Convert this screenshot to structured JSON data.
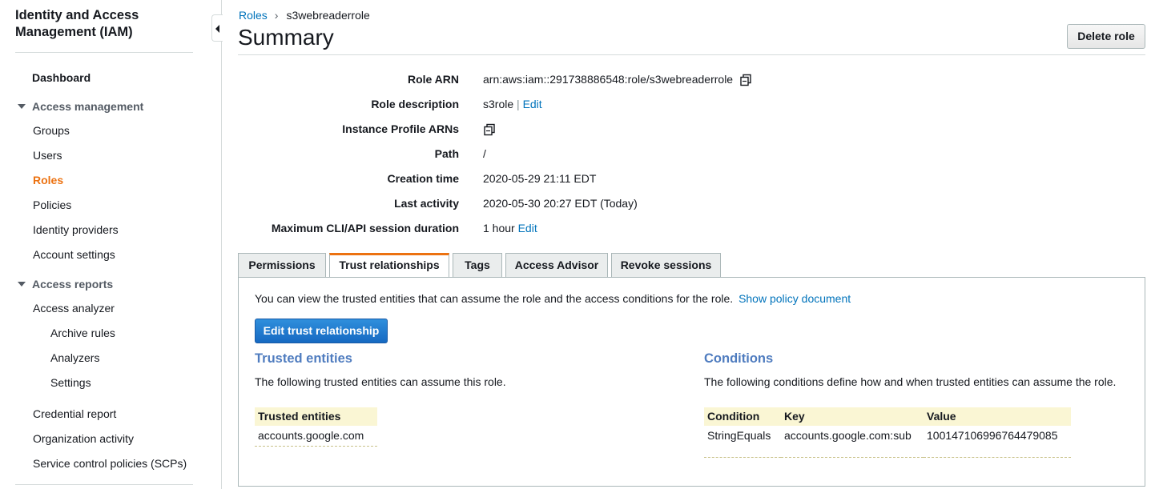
{
  "sidebar": {
    "title": "Identity and Access Management (IAM)",
    "dashboard": "Dashboard",
    "access_management": {
      "label": "Access management",
      "items": [
        "Groups",
        "Users",
        "Roles",
        "Policies",
        "Identity providers",
        "Account settings"
      ]
    },
    "access_reports": {
      "label": "Access reports",
      "analyzer": "Access analyzer",
      "analyzer_items": [
        "Archive rules",
        "Analyzers",
        "Settings"
      ],
      "items": [
        "Credential report",
        "Organization activity",
        "Service control policies (SCPs)"
      ]
    }
  },
  "breadcrumb": {
    "parent": "Roles",
    "current": "s3webreaderrole"
  },
  "page": {
    "title": "Summary",
    "delete_button": "Delete role"
  },
  "summary": {
    "role_arn_label": "Role ARN",
    "role_arn": "arn:aws:iam::291738886548:role/s3webreaderrole",
    "description_label": "Role description",
    "description": "s3role",
    "description_sep": "|",
    "description_edit": "Edit",
    "instance_profile_label": "Instance Profile ARNs",
    "path_label": "Path",
    "path": "/",
    "creation_label": "Creation time",
    "creation": "2020-05-29 21:11 EDT",
    "last_activity_label": "Last activity",
    "last_activity": "2020-05-30 20:27 EDT (Today)",
    "session_label": "Maximum CLI/API session duration",
    "session": "1 hour",
    "session_edit": "Edit"
  },
  "tabs": [
    "Permissions",
    "Trust relationships",
    "Tags",
    "Access Advisor",
    "Revoke sessions"
  ],
  "active_tab": "Trust relationships",
  "trust": {
    "intro": "You can view the trusted entities that can assume the role and the access conditions for the role.",
    "show_policy": "Show policy document",
    "edit_button": "Edit trust relationship",
    "entities_heading": "Trusted entities",
    "entities_desc": "The following trusted entities can assume this role.",
    "entities_col": "Trusted entities",
    "entities": [
      "accounts.google.com"
    ],
    "conditions_heading": "Conditions",
    "conditions_desc": "The following conditions define how and when trusted entities can assume the role.",
    "conditions_cols": [
      "Condition",
      "Key",
      "Value"
    ],
    "conditions": [
      [
        "StringEquals",
        "accounts.google.com:sub",
        "100147106996764479085"
      ]
    ]
  },
  "colors": {
    "accent_orange": "#ec7211",
    "link_blue": "#0073bb",
    "heading_blue": "#4f7cbf",
    "primary_button": "#1669c2"
  }
}
